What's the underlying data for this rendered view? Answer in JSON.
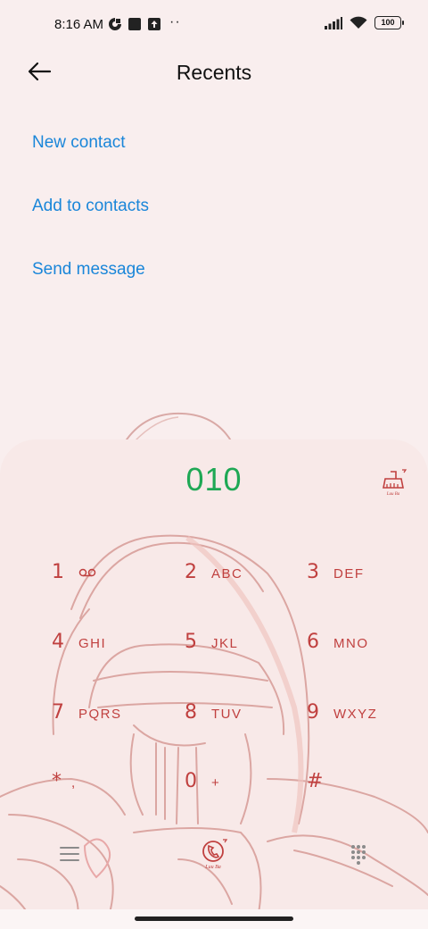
{
  "status_bar": {
    "time": "8:16 AM",
    "dots": "··",
    "battery": "100",
    "icons": [
      "camera-app-icon",
      "square-notification-icon",
      "upload-icon",
      "signal-icon",
      "wifi-icon",
      "battery-icon"
    ]
  },
  "header": {
    "title": "Recents",
    "back_icon": "back-arrow-icon"
  },
  "actions": {
    "new_contact": "New contact",
    "add_to_contacts": "Add to contacts",
    "send_message": "Send message"
  },
  "dialer": {
    "number": "010",
    "clear_icon": "clear-broom-icon",
    "keys": [
      {
        "digit": "1",
        "letters": "",
        "icon": "voicemail-icon"
      },
      {
        "digit": "2",
        "letters": "ABC"
      },
      {
        "digit": "3",
        "letters": "DEF"
      },
      {
        "digit": "4",
        "letters": "GHI"
      },
      {
        "digit": "5",
        "letters": "JKL"
      },
      {
        "digit": "6",
        "letters": "MNO"
      },
      {
        "digit": "7",
        "letters": "PQRS"
      },
      {
        "digit": "8",
        "letters": "TUV"
      },
      {
        "digit": "9",
        "letters": "WXYZ"
      },
      {
        "digit": "*",
        "letters": ","
      },
      {
        "digit": "0",
        "letters": "+"
      },
      {
        "digit": "#",
        "letters": ""
      }
    ],
    "bottom_icons": [
      "menu-icon",
      "call-icon",
      "keypad-icon"
    ]
  },
  "colors": {
    "accent_link": "#1a86d9",
    "number_green": "#1fa855",
    "key_red": "#c0403f",
    "background": "#f9eeee"
  }
}
